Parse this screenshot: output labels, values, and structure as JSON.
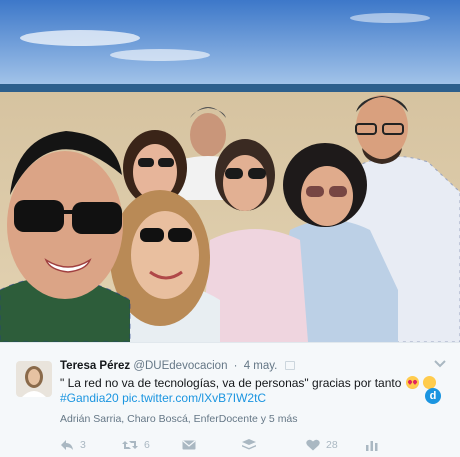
{
  "tweet": {
    "author_name": "Teresa Pérez",
    "author_handle": "@DUEdevocacion",
    "separator": "·",
    "date": "4 may.",
    "text_line1": "\" La red no va de tecnologías, va de personas\" gracias por tanto",
    "hashtag": "#Gandia20",
    "link": "pic.twitter.com/lXvB7IW2tC",
    "tagged": "Adrián Sarria, Charo Boscá, EnferDocente y 5 más",
    "icons": {
      "dsite": "d"
    }
  },
  "actions": {
    "reply_count": "3",
    "retweet_count": "6",
    "like_count": "28"
  },
  "colors": {
    "link": "#1b95e0",
    "muted": "#657786",
    "card_bg": "#f5f8fa"
  }
}
